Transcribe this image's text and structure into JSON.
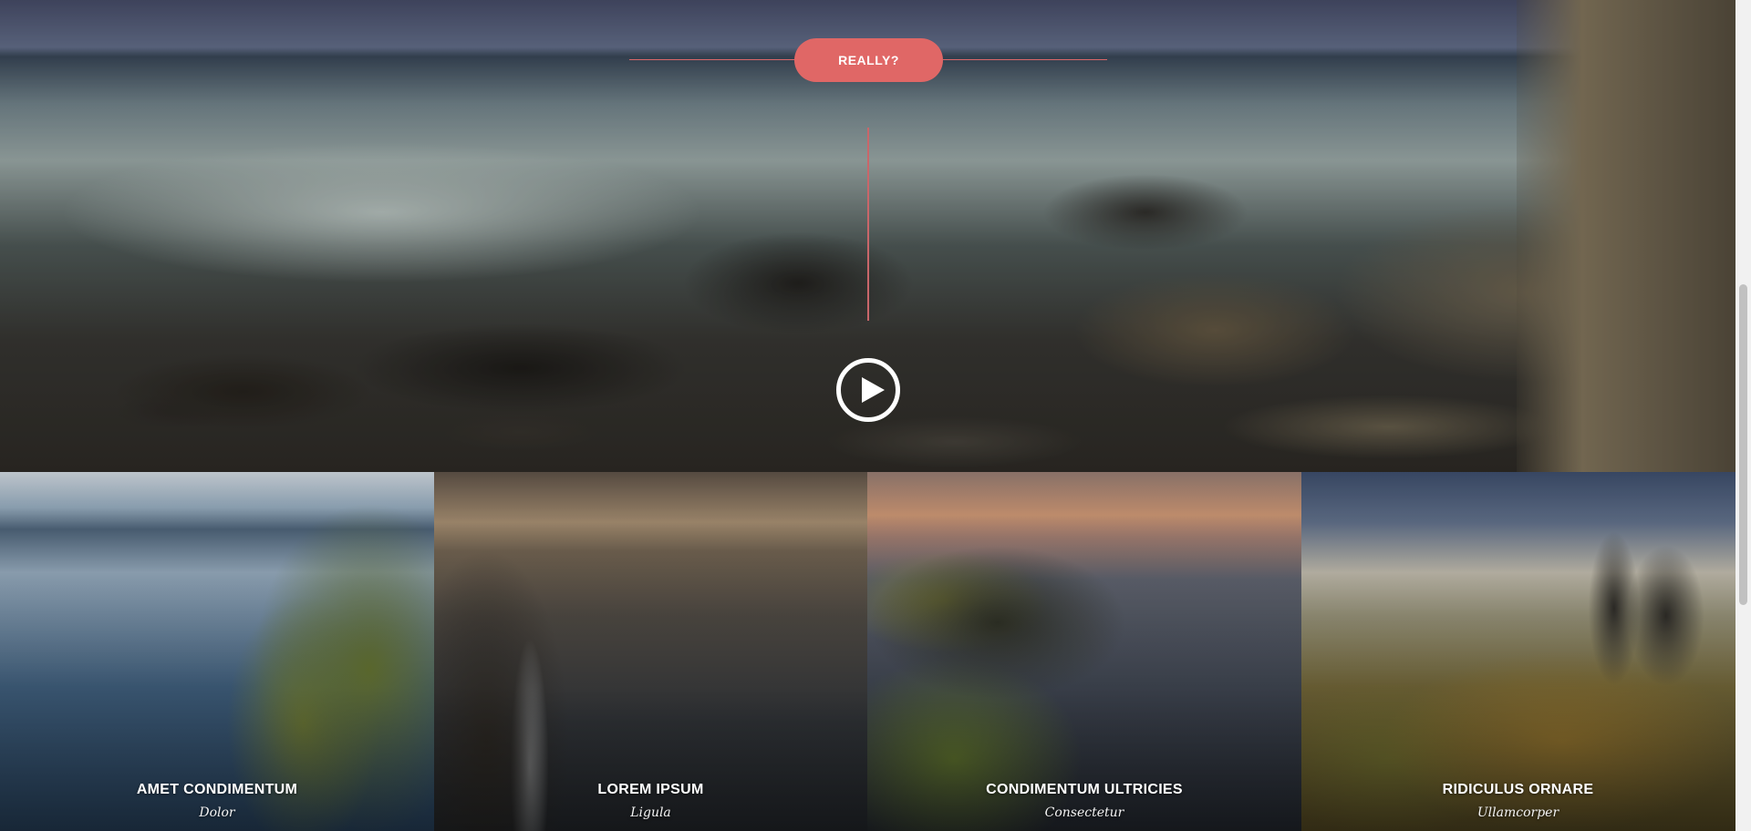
{
  "hero": {
    "button_label": "REALLY?",
    "play_icon": "play-icon"
  },
  "tiles": [
    {
      "title": "AMET CONDIMENTUM",
      "subtitle": "Dolor"
    },
    {
      "title": "LOREM IPSUM",
      "subtitle": "Ligula"
    },
    {
      "title": "CONDIMENTUM ULTRICIES",
      "subtitle": "Consectetur"
    },
    {
      "title": "RIDICULUS ORNARE",
      "subtitle": "Ullamcorper"
    }
  ],
  "colors": {
    "accent": "#e06766",
    "text": "#ffffff"
  }
}
